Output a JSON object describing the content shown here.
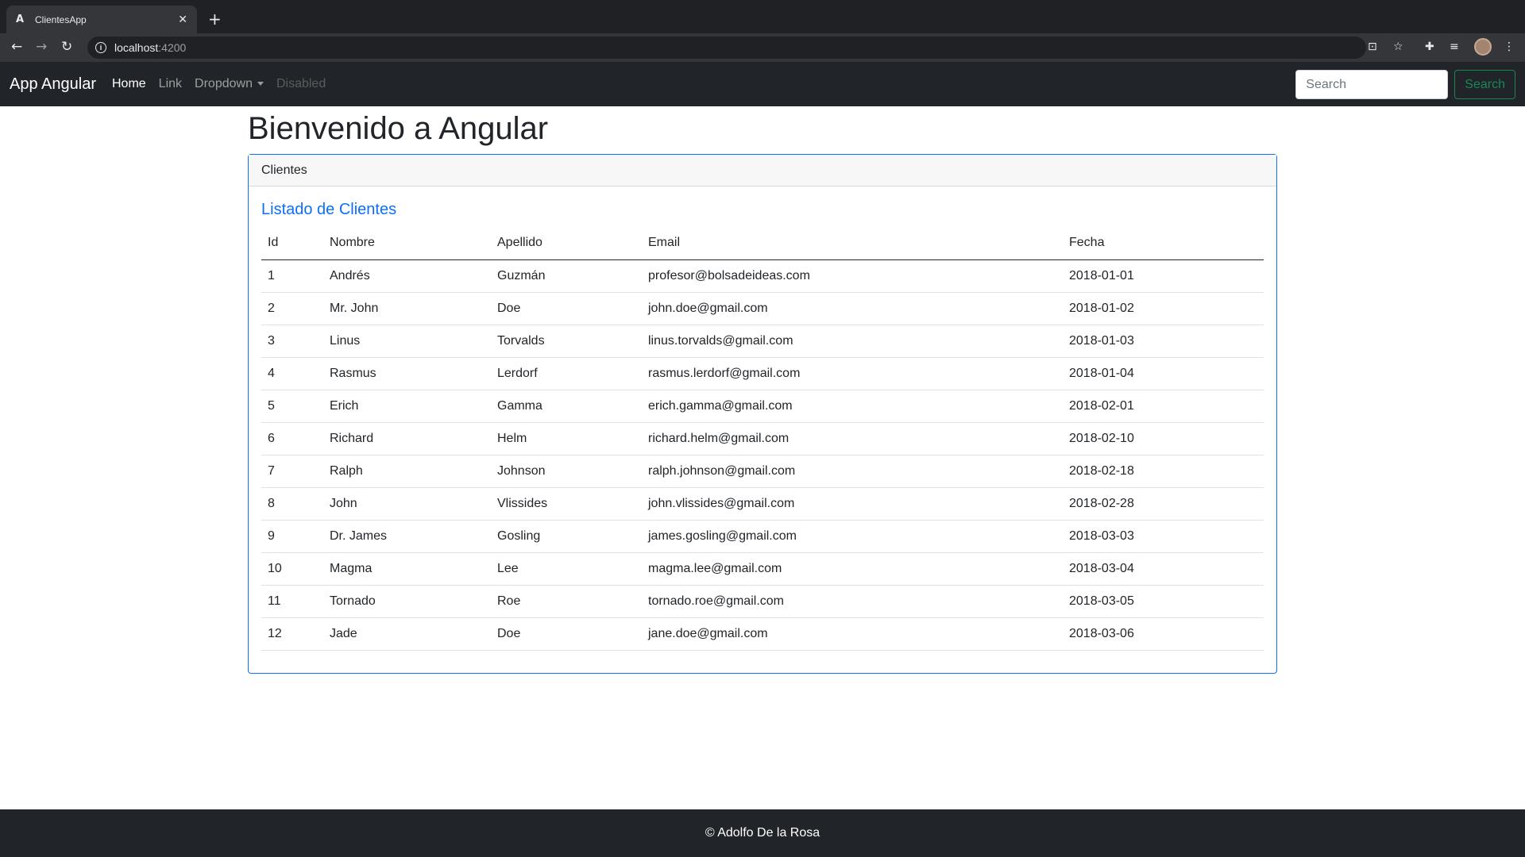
{
  "browser": {
    "tab_title": "ClientesApp",
    "tab_favicon": "A",
    "url_host": "localhost",
    "url_port": ":4200"
  },
  "navbar": {
    "brand": "App Angular",
    "links": [
      "Home",
      "Link",
      "Dropdown",
      "Disabled"
    ],
    "search_placeholder": "Search",
    "search_button": "Search"
  },
  "page": {
    "title": "Bienvenido a Angular"
  },
  "card": {
    "header": "Clientes",
    "title": "Listado de Clientes",
    "table": {
      "columns": [
        "Id",
        "Nombre",
        "Apellido",
        "Email",
        "Fecha"
      ],
      "rows": [
        [
          "1",
          "Andrés",
          "Guzmán",
          "profesor@bolsadeideas.com",
          "2018-01-01"
        ],
        [
          "2",
          "Mr. John",
          "Doe",
          "john.doe@gmail.com",
          "2018-01-02"
        ],
        [
          "3",
          "Linus",
          "Torvalds",
          "linus.torvalds@gmail.com",
          "2018-01-03"
        ],
        [
          "4",
          "Rasmus",
          "Lerdorf",
          "rasmus.lerdorf@gmail.com",
          "2018-01-04"
        ],
        [
          "5",
          "Erich",
          "Gamma",
          "erich.gamma@gmail.com",
          "2018-02-01"
        ],
        [
          "6",
          "Richard",
          "Helm",
          "richard.helm@gmail.com",
          "2018-02-10"
        ],
        [
          "7",
          "Ralph",
          "Johnson",
          "ralph.johnson@gmail.com",
          "2018-02-18"
        ],
        [
          "8",
          "John",
          "Vlissides",
          "john.vlissides@gmail.com",
          "2018-02-28"
        ],
        [
          "9",
          "Dr. James",
          "Gosling",
          "james.gosling@gmail.com",
          "2018-03-03"
        ],
        [
          "10",
          "Magma",
          "Lee",
          "magma.lee@gmail.com",
          "2018-03-04"
        ],
        [
          "11",
          "Tornado",
          "Roe",
          "tornado.roe@gmail.com",
          "2018-03-05"
        ],
        [
          "12",
          "Jade",
          "Doe",
          "jane.doe@gmail.com",
          "2018-03-06"
        ]
      ]
    }
  },
  "footer": {
    "text": "© Adolfo De la Rosa"
  },
  "colors": {
    "navbar_bg": "#212529",
    "primary": "#0d6efd",
    "success": "#198754"
  }
}
